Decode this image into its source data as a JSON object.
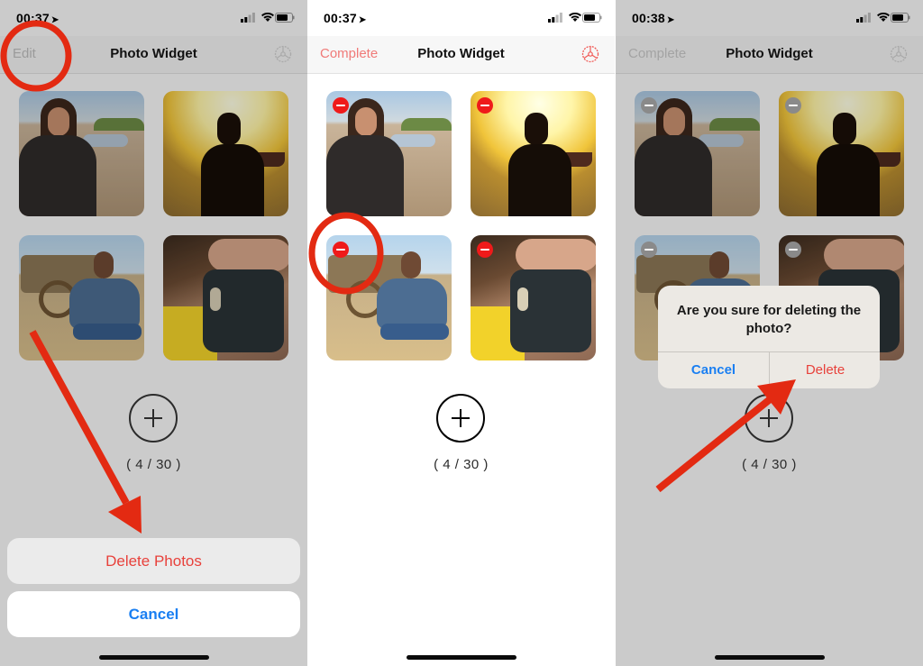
{
  "colors": {
    "accent_red": "#e8413b",
    "ios_blue": "#1a7ff2",
    "annotation_red": "#e32a12",
    "delete_badge_red": "#ef1a1a"
  },
  "panels": [
    {
      "status": {
        "time": "00:37",
        "location_icon": "location-arrow-icon"
      },
      "navbar": {
        "left_label": "Edit",
        "title": "Photo Widget",
        "right_icon": "gear-icon"
      },
      "photos": [
        "portrait-beach",
        "silhouette-sunset",
        "sitting-by-cart",
        "selfie-phone"
      ],
      "add_icon": "plus-circle-icon",
      "count": "( 4 / 30 )",
      "action_sheet": {
        "delete_label": "Delete Photos",
        "cancel_label": "Cancel"
      }
    },
    {
      "status": {
        "time": "00:37",
        "location_icon": "location-arrow-icon"
      },
      "navbar": {
        "left_label": "Complete",
        "title": "Photo Widget",
        "right_icon": "gear-icon"
      },
      "photos": [
        "portrait-beach",
        "silhouette-sunset",
        "sitting-by-cart",
        "selfie-phone"
      ],
      "delete_badge_icon": "minus-circle-icon",
      "add_icon": "plus-circle-icon",
      "count": "( 4 / 30 )"
    },
    {
      "status": {
        "time": "00:38",
        "location_icon": "location-arrow-icon"
      },
      "navbar": {
        "left_label": "Complete",
        "title": "Photo Widget",
        "right_icon": "gear-icon"
      },
      "photos": [
        "portrait-beach",
        "silhouette-sunset",
        "sitting-by-cart",
        "selfie-phone"
      ],
      "delete_badge_icon": "minus-circle-icon",
      "add_icon": "plus-circle-icon",
      "count": "( 4 / 30 )",
      "alert": {
        "message": "Are you sure for deleting the photo?",
        "cancel_label": "Cancel",
        "delete_label": "Delete"
      }
    }
  ],
  "annotations": [
    "circle around Edit",
    "arrow to Delete Photos",
    "circle around delete badge",
    "arrow to Delete"
  ]
}
